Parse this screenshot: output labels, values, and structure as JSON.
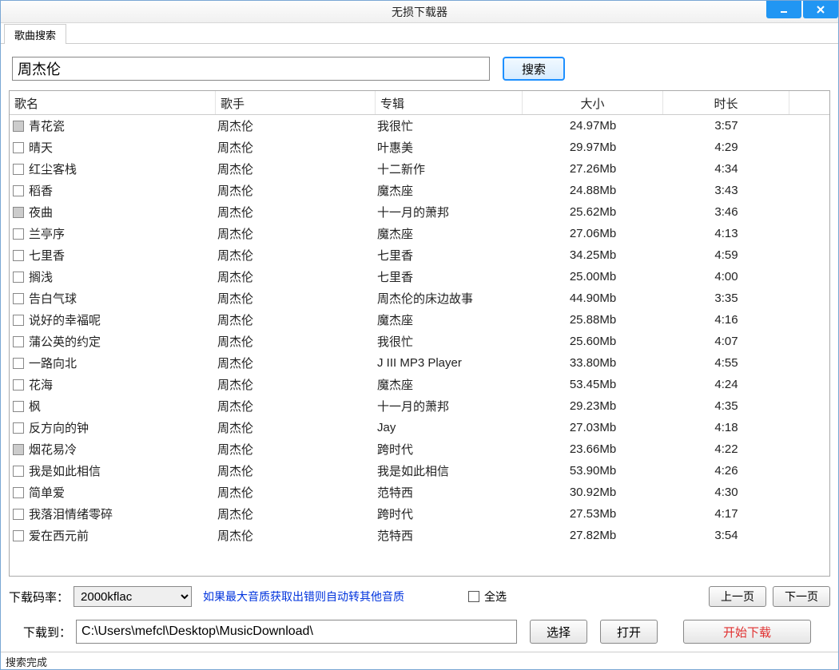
{
  "window": {
    "title": "无损下载器"
  },
  "tabs": {
    "search_tab": "歌曲搜索"
  },
  "search": {
    "value": "周杰伦",
    "button": "搜索"
  },
  "table": {
    "headers": {
      "song": "歌名",
      "artist": "歌手",
      "album": "专辑",
      "size": "大小",
      "dur": "时长"
    },
    "rows": [
      {
        "song": "青花瓷",
        "artist": "周杰伦",
        "album": "我很忙",
        "size": "24.97Mb",
        "dur": "3:57",
        "gray": true
      },
      {
        "song": "晴天",
        "artist": "周杰伦",
        "album": "叶惠美",
        "size": "29.97Mb",
        "dur": "4:29",
        "gray": false
      },
      {
        "song": "红尘客栈",
        "artist": "周杰伦",
        "album": "十二新作",
        "size": "27.26Mb",
        "dur": "4:34",
        "gray": false
      },
      {
        "song": "稻香",
        "artist": "周杰伦",
        "album": "魔杰座",
        "size": "24.88Mb",
        "dur": "3:43",
        "gray": false
      },
      {
        "song": "夜曲",
        "artist": "周杰伦",
        "album": "十一月的萧邦",
        "size": "25.62Mb",
        "dur": "3:46",
        "gray": true
      },
      {
        "song": "兰亭序",
        "artist": "周杰伦",
        "album": "魔杰座",
        "size": "27.06Mb",
        "dur": "4:13",
        "gray": false
      },
      {
        "song": "七里香",
        "artist": "周杰伦",
        "album": "七里香",
        "size": "34.25Mb",
        "dur": "4:59",
        "gray": false
      },
      {
        "song": "搁浅",
        "artist": "周杰伦",
        "album": "七里香",
        "size": "25.00Mb",
        "dur": "4:00",
        "gray": false
      },
      {
        "song": "告白气球",
        "artist": "周杰伦",
        "album": "周杰伦的床边故事",
        "size": "44.90Mb",
        "dur": "3:35",
        "gray": false
      },
      {
        "song": "说好的幸福呢",
        "artist": "周杰伦",
        "album": "魔杰座",
        "size": "25.88Mb",
        "dur": "4:16",
        "gray": false
      },
      {
        "song": "蒲公英的约定",
        "artist": "周杰伦",
        "album": "我很忙",
        "size": "25.60Mb",
        "dur": "4:07",
        "gray": false
      },
      {
        "song": "一路向北",
        "artist": "周杰伦",
        "album": "J III MP3 Player",
        "size": "33.80Mb",
        "dur": "4:55",
        "gray": false
      },
      {
        "song": "花海",
        "artist": "周杰伦",
        "album": "魔杰座",
        "size": "53.45Mb",
        "dur": "4:24",
        "gray": false
      },
      {
        "song": "枫",
        "artist": "周杰伦",
        "album": "十一月的萧邦",
        "size": "29.23Mb",
        "dur": "4:35",
        "gray": false
      },
      {
        "song": "反方向的钟",
        "artist": "周杰伦",
        "album": "Jay",
        "size": "27.03Mb",
        "dur": "4:18",
        "gray": false
      },
      {
        "song": "烟花易冷",
        "artist": "周杰伦",
        "album": "跨时代",
        "size": "23.66Mb",
        "dur": "4:22",
        "gray": true
      },
      {
        "song": "我是如此相信",
        "artist": "周杰伦",
        "album": "我是如此相信",
        "size": "53.90Mb",
        "dur": "4:26",
        "gray": false
      },
      {
        "song": "简单爱",
        "artist": "周杰伦",
        "album": "范特西",
        "size": "30.92Mb",
        "dur": "4:30",
        "gray": false
      },
      {
        "song": "我落泪情绪零碎",
        "artist": "周杰伦",
        "album": "跨时代",
        "size": "27.53Mb",
        "dur": "4:17",
        "gray": false
      },
      {
        "song": "爱在西元前",
        "artist": "周杰伦",
        "album": "范特西",
        "size": "27.82Mb",
        "dur": "3:54",
        "gray": false
      }
    ]
  },
  "footer": {
    "bitrate_label": "下载码率：",
    "bitrate_value": "2000kflac",
    "hint": "如果最大音质获取出错则自动转其他音质",
    "select_all": "全选",
    "prev_page": "上一页",
    "next_page": "下一页",
    "download_to": "下载到：",
    "path": "C:\\Users\\mefcl\\Desktop\\MusicDownload\\",
    "choose": "选择",
    "open": "打开",
    "start": "开始下载"
  },
  "status": "搜索完成"
}
